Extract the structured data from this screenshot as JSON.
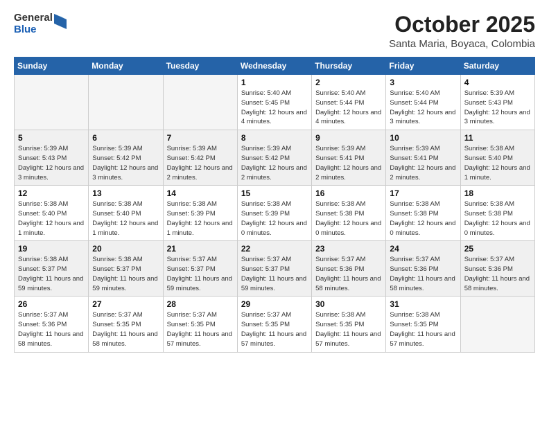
{
  "header": {
    "logo_general": "General",
    "logo_blue": "Blue",
    "month": "October 2025",
    "location": "Santa Maria, Boyaca, Colombia"
  },
  "days_of_week": [
    "Sunday",
    "Monday",
    "Tuesday",
    "Wednesday",
    "Thursday",
    "Friday",
    "Saturday"
  ],
  "weeks": [
    {
      "shaded": false,
      "days": [
        {
          "num": "",
          "info": ""
        },
        {
          "num": "",
          "info": ""
        },
        {
          "num": "",
          "info": ""
        },
        {
          "num": "1",
          "info": "Sunrise: 5:40 AM\nSunset: 5:45 PM\nDaylight: 12 hours\nand 4 minutes."
        },
        {
          "num": "2",
          "info": "Sunrise: 5:40 AM\nSunset: 5:44 PM\nDaylight: 12 hours\nand 4 minutes."
        },
        {
          "num": "3",
          "info": "Sunrise: 5:40 AM\nSunset: 5:44 PM\nDaylight: 12 hours\nand 3 minutes."
        },
        {
          "num": "4",
          "info": "Sunrise: 5:39 AM\nSunset: 5:43 PM\nDaylight: 12 hours\nand 3 minutes."
        }
      ]
    },
    {
      "shaded": true,
      "days": [
        {
          "num": "5",
          "info": "Sunrise: 5:39 AM\nSunset: 5:43 PM\nDaylight: 12 hours\nand 3 minutes."
        },
        {
          "num": "6",
          "info": "Sunrise: 5:39 AM\nSunset: 5:42 PM\nDaylight: 12 hours\nand 3 minutes."
        },
        {
          "num": "7",
          "info": "Sunrise: 5:39 AM\nSunset: 5:42 PM\nDaylight: 12 hours\nand 2 minutes."
        },
        {
          "num": "8",
          "info": "Sunrise: 5:39 AM\nSunset: 5:42 PM\nDaylight: 12 hours\nand 2 minutes."
        },
        {
          "num": "9",
          "info": "Sunrise: 5:39 AM\nSunset: 5:41 PM\nDaylight: 12 hours\nand 2 minutes."
        },
        {
          "num": "10",
          "info": "Sunrise: 5:39 AM\nSunset: 5:41 PM\nDaylight: 12 hours\nand 2 minutes."
        },
        {
          "num": "11",
          "info": "Sunrise: 5:38 AM\nSunset: 5:40 PM\nDaylight: 12 hours\nand 1 minute."
        }
      ]
    },
    {
      "shaded": false,
      "days": [
        {
          "num": "12",
          "info": "Sunrise: 5:38 AM\nSunset: 5:40 PM\nDaylight: 12 hours\nand 1 minute."
        },
        {
          "num": "13",
          "info": "Sunrise: 5:38 AM\nSunset: 5:40 PM\nDaylight: 12 hours\nand 1 minute."
        },
        {
          "num": "14",
          "info": "Sunrise: 5:38 AM\nSunset: 5:39 PM\nDaylight: 12 hours\nand 1 minute."
        },
        {
          "num": "15",
          "info": "Sunrise: 5:38 AM\nSunset: 5:39 PM\nDaylight: 12 hours\nand 0 minutes."
        },
        {
          "num": "16",
          "info": "Sunrise: 5:38 AM\nSunset: 5:38 PM\nDaylight: 12 hours\nand 0 minutes."
        },
        {
          "num": "17",
          "info": "Sunrise: 5:38 AM\nSunset: 5:38 PM\nDaylight: 12 hours\nand 0 minutes."
        },
        {
          "num": "18",
          "info": "Sunrise: 5:38 AM\nSunset: 5:38 PM\nDaylight: 12 hours\nand 0 minutes."
        }
      ]
    },
    {
      "shaded": true,
      "days": [
        {
          "num": "19",
          "info": "Sunrise: 5:38 AM\nSunset: 5:37 PM\nDaylight: 11 hours\nand 59 minutes."
        },
        {
          "num": "20",
          "info": "Sunrise: 5:38 AM\nSunset: 5:37 PM\nDaylight: 11 hours\nand 59 minutes."
        },
        {
          "num": "21",
          "info": "Sunrise: 5:37 AM\nSunset: 5:37 PM\nDaylight: 11 hours\nand 59 minutes."
        },
        {
          "num": "22",
          "info": "Sunrise: 5:37 AM\nSunset: 5:37 PM\nDaylight: 11 hours\nand 59 minutes."
        },
        {
          "num": "23",
          "info": "Sunrise: 5:37 AM\nSunset: 5:36 PM\nDaylight: 11 hours\nand 58 minutes."
        },
        {
          "num": "24",
          "info": "Sunrise: 5:37 AM\nSunset: 5:36 PM\nDaylight: 11 hours\nand 58 minutes."
        },
        {
          "num": "25",
          "info": "Sunrise: 5:37 AM\nSunset: 5:36 PM\nDaylight: 11 hours\nand 58 minutes."
        }
      ]
    },
    {
      "shaded": false,
      "days": [
        {
          "num": "26",
          "info": "Sunrise: 5:37 AM\nSunset: 5:36 PM\nDaylight: 11 hours\nand 58 minutes."
        },
        {
          "num": "27",
          "info": "Sunrise: 5:37 AM\nSunset: 5:35 PM\nDaylight: 11 hours\nand 58 minutes."
        },
        {
          "num": "28",
          "info": "Sunrise: 5:37 AM\nSunset: 5:35 PM\nDaylight: 11 hours\nand 57 minutes."
        },
        {
          "num": "29",
          "info": "Sunrise: 5:37 AM\nSunset: 5:35 PM\nDaylight: 11 hours\nand 57 minutes."
        },
        {
          "num": "30",
          "info": "Sunrise: 5:38 AM\nSunset: 5:35 PM\nDaylight: 11 hours\nand 57 minutes."
        },
        {
          "num": "31",
          "info": "Sunrise: 5:38 AM\nSunset: 5:35 PM\nDaylight: 11 hours\nand 57 minutes."
        },
        {
          "num": "",
          "info": ""
        }
      ]
    }
  ]
}
